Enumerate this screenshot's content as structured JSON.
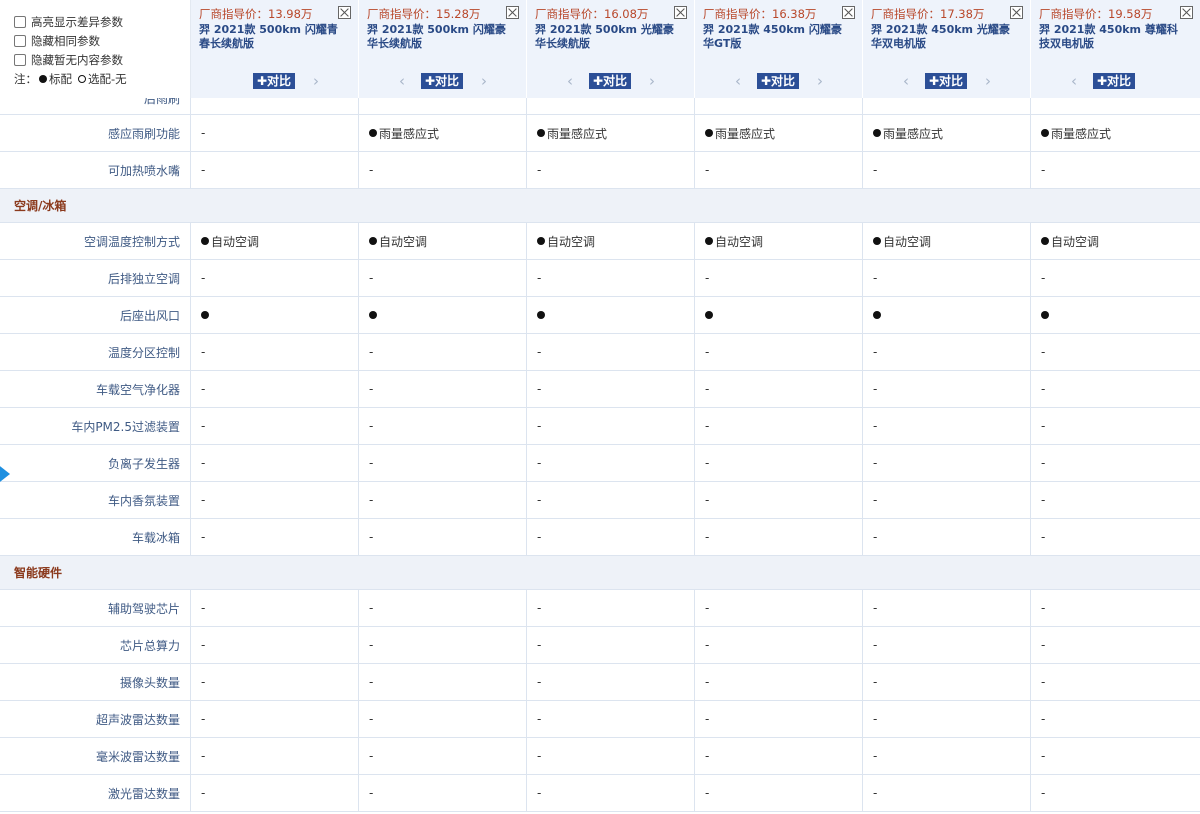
{
  "options": {
    "items": [
      {
        "label": "高亮显示差异参数"
      },
      {
        "label": "隐藏相同参数"
      },
      {
        "label": "隐藏暂无内容参数"
      }
    ],
    "note_prefix": "注：",
    "note_std": "标配",
    "note_opt": "选配",
    "note_none": "-无"
  },
  "cars": [
    {
      "price": "厂商指导价：13.98万",
      "name": "羿 2021款 500km 闪耀青春长续航版",
      "compare_label": "✚对比"
    },
    {
      "price": "厂商指导价：15.28万",
      "name": "羿 2021款 500km 闪耀豪华长续航版",
      "compare_label": "✚对比"
    },
    {
      "price": "厂商指导价：16.08万",
      "name": "羿 2021款 500km 光耀豪华长续航版",
      "compare_label": "✚对比"
    },
    {
      "price": "厂商指导价：16.38万",
      "name": "羿 2021款 450km 闪耀豪华GT版",
      "compare_label": "✚对比"
    },
    {
      "price": "厂商指导价：17.38万",
      "name": "羿 2021款 450km 光耀豪华双电机版",
      "compare_label": "✚对比"
    },
    {
      "price": "厂商指导价：19.58万",
      "name": "羿 2021款 450km 尊耀科技双电机版",
      "compare_label": "✚对比"
    }
  ],
  "partial_row": {
    "label": "后雨刷",
    "values": [
      "",
      "",
      "",
      "",
      "",
      ""
    ]
  },
  "rows_a": [
    {
      "label": "感应雨刷功能",
      "values": [
        "-",
        "雨量感应式",
        "雨量感应式",
        "雨量感应式",
        "雨量感应式",
        "雨量感应式"
      ],
      "dots": [
        false,
        true,
        true,
        true,
        true,
        true
      ]
    },
    {
      "label": "可加热喷水嘴",
      "values": [
        "-",
        "-",
        "-",
        "-",
        "-",
        "-"
      ],
      "dots": [
        false,
        false,
        false,
        false,
        false,
        false
      ]
    }
  ],
  "section_ac": "空调/冰箱",
  "rows_b": [
    {
      "label": "空调温度控制方式",
      "values": [
        "自动空调",
        "自动空调",
        "自动空调",
        "自动空调",
        "自动空调",
        "自动空调"
      ],
      "dots": [
        true,
        true,
        true,
        true,
        true,
        true
      ]
    },
    {
      "label": "后排独立空调",
      "values": [
        "-",
        "-",
        "-",
        "-",
        "-",
        "-"
      ],
      "dots": [
        false,
        false,
        false,
        false,
        false,
        false
      ]
    },
    {
      "label": "后座出风口",
      "values": [
        "",
        "",
        "",
        "",
        "",
        ""
      ],
      "dots": [
        true,
        true,
        true,
        true,
        true,
        true
      ]
    },
    {
      "label": "温度分区控制",
      "values": [
        "-",
        "-",
        "-",
        "-",
        "-",
        "-"
      ],
      "dots": [
        false,
        false,
        false,
        false,
        false,
        false
      ]
    },
    {
      "label": "车载空气净化器",
      "values": [
        "-",
        "-",
        "-",
        "-",
        "-",
        "-"
      ],
      "dots": [
        false,
        false,
        false,
        false,
        false,
        false
      ]
    },
    {
      "label": "车内PM2.5过滤装置",
      "values": [
        "-",
        "-",
        "-",
        "-",
        "-",
        "-"
      ],
      "dots": [
        false,
        false,
        false,
        false,
        false,
        false
      ]
    },
    {
      "label": "负离子发生器",
      "values": [
        "-",
        "-",
        "-",
        "-",
        "-",
        "-"
      ],
      "dots": [
        false,
        false,
        false,
        false,
        false,
        false
      ]
    },
    {
      "label": "车内香氛装置",
      "values": [
        "-",
        "-",
        "-",
        "-",
        "-",
        "-"
      ],
      "dots": [
        false,
        false,
        false,
        false,
        false,
        false
      ]
    },
    {
      "label": "车载冰箱",
      "values": [
        "-",
        "-",
        "-",
        "-",
        "-",
        "-"
      ],
      "dots": [
        false,
        false,
        false,
        false,
        false,
        false
      ]
    }
  ],
  "section_hw": "智能硬件",
  "rows_c": [
    {
      "label": "辅助驾驶芯片",
      "values": [
        "-",
        "-",
        "-",
        "-",
        "-",
        "-"
      ],
      "dots": [
        false,
        false,
        false,
        false,
        false,
        false
      ]
    },
    {
      "label": "芯片总算力",
      "values": [
        "-",
        "-",
        "-",
        "-",
        "-",
        "-"
      ],
      "dots": [
        false,
        false,
        false,
        false,
        false,
        false
      ]
    },
    {
      "label": "摄像头数量",
      "values": [
        "-",
        "-",
        "-",
        "-",
        "-",
        "-"
      ],
      "dots": [
        false,
        false,
        false,
        false,
        false,
        false
      ]
    },
    {
      "label": "超声波雷达数量",
      "values": [
        "-",
        "-",
        "-",
        "-",
        "-",
        "-"
      ],
      "dots": [
        false,
        false,
        false,
        false,
        false,
        false
      ]
    },
    {
      "label": "毫米波雷达数量",
      "values": [
        "-",
        "-",
        "-",
        "-",
        "-",
        "-"
      ],
      "dots": [
        false,
        false,
        false,
        false,
        false,
        false
      ]
    },
    {
      "label": "激光雷达数量",
      "values": [
        "-",
        "-",
        "-",
        "-",
        "-",
        "-"
      ],
      "dots": [
        false,
        false,
        false,
        false,
        false,
        false
      ]
    }
  ],
  "colors": {
    "accent": "#2c4f97",
    "price": "#b8472a",
    "section": "#8b3a1d",
    "handle": "#1e8fe0"
  }
}
